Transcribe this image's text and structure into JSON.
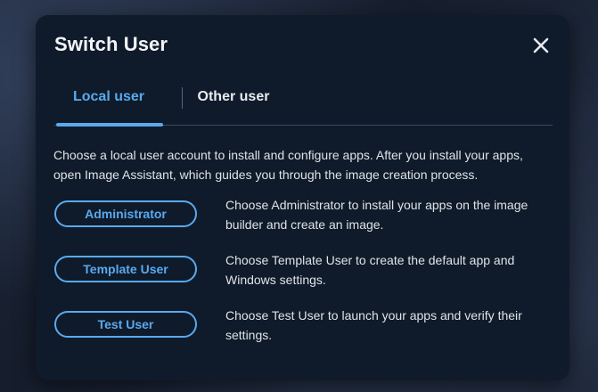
{
  "dialog": {
    "title": "Switch User",
    "close_icon": "close-icon"
  },
  "tabs": [
    {
      "label": "Local user",
      "selected": true
    },
    {
      "label": "Other user",
      "selected": false
    }
  ],
  "description": "Choose a local user account to install and configure apps. After you install your apps, open Image Assistant, which guides you through the image creation process.",
  "options": [
    {
      "button": "Administrator",
      "text": "Choose Administrator to install your apps on the image builder and create an image."
    },
    {
      "button": "Template User",
      "text": "Choose Template User to create the default app and Windows settings."
    },
    {
      "button": "Test User",
      "text": "Choose Test User to launch your apps and verify their settings."
    }
  ],
  "colors": {
    "accent": "#5aa9ef",
    "modal_bg": "#0f1b2a"
  }
}
